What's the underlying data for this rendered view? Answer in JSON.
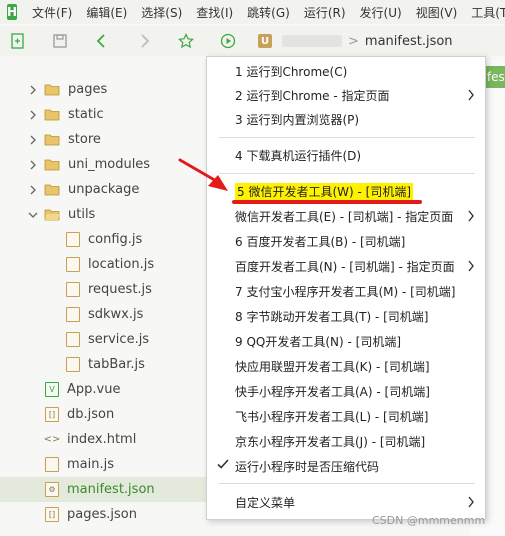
{
  "menubar": {
    "logo": "H",
    "items": [
      "文件(F)",
      "编辑(E)",
      "选择(S)",
      "查找(I)",
      "跳转(G)",
      "运行(R)",
      "发行(U)",
      "视图(V)",
      "工具(T)"
    ]
  },
  "toolbar": {
    "icons": [
      "new-file-icon",
      "save-icon",
      "back-icon",
      "forward-icon",
      "star-icon",
      "run-icon"
    ],
    "tab_badge": "U",
    "breadcrumb_sep": ">",
    "breadcrumb_file": "manifest.json"
  },
  "editor": {
    "tab_label": "nifest"
  },
  "tree": {
    "items": [
      {
        "label": "pages",
        "type": "folder"
      },
      {
        "label": "static",
        "type": "folder"
      },
      {
        "label": "store",
        "type": "folder"
      },
      {
        "label": "uni_modules",
        "type": "folder"
      },
      {
        "label": "unpackage",
        "type": "folder"
      },
      {
        "label": "utils",
        "type": "folder-open"
      },
      {
        "label": "config.js",
        "type": "file"
      },
      {
        "label": "location.js",
        "type": "file"
      },
      {
        "label": "request.js",
        "type": "file"
      },
      {
        "label": "sdkwx.js",
        "type": "file"
      },
      {
        "label": "service.js",
        "type": "file"
      },
      {
        "label": "tabBar.js",
        "type": "file"
      },
      {
        "label": "App.vue",
        "type": "file"
      },
      {
        "label": "db.json",
        "type": "file"
      },
      {
        "label": "index.html",
        "type": "file"
      },
      {
        "label": "main.js",
        "type": "file"
      },
      {
        "label": "manifest.json",
        "type": "file",
        "selected": true
      },
      {
        "label": "pages.json",
        "type": "file"
      }
    ]
  },
  "menu": {
    "items": [
      {
        "label": "1 运行到Chrome(C)"
      },
      {
        "label": "2 运行到Chrome - 指定页面",
        "submenu": true
      },
      {
        "label": "3 运行到内置浏览器(P)"
      },
      {
        "label": "4 下载真机运行插件(D)"
      },
      {
        "label": "5 微信开发者工具(W) - [司机端]",
        "highlight": true
      },
      {
        "label": "微信开发者工具(E) - [司机端] - 指定页面",
        "submenu": true
      },
      {
        "label": "6 百度开发者工具(B) - [司机端]"
      },
      {
        "label": "百度开发者工具(N) - [司机端] - 指定页面",
        "submenu": true
      },
      {
        "label": "7 支付宝小程序开发者工具(M) - [司机端]"
      },
      {
        "label": "8 字节跳动开发者工具(T) - [司机端]"
      },
      {
        "label": "9 QQ开发者工具(N) - [司机端]"
      },
      {
        "label": "快应用联盟开发者工具(K) - [司机端]"
      },
      {
        "label": "快手小程序开发者工具(A) - [司机端]"
      },
      {
        "label": "飞书小程序开发者工具(L) - [司机端]"
      },
      {
        "label": "京东小程序开发者工具(J) - [司机端]"
      },
      {
        "label": "运行小程序时是否压缩代码",
        "checked": true
      },
      {
        "label": "自定义菜单",
        "submenu": true
      }
    ]
  },
  "watermark": "CSDN @mmmenmm",
  "colors": {
    "accent_green": "#3aa944",
    "highlight_yellow": "#fff200",
    "annotation_red": "#e41b1b"
  }
}
